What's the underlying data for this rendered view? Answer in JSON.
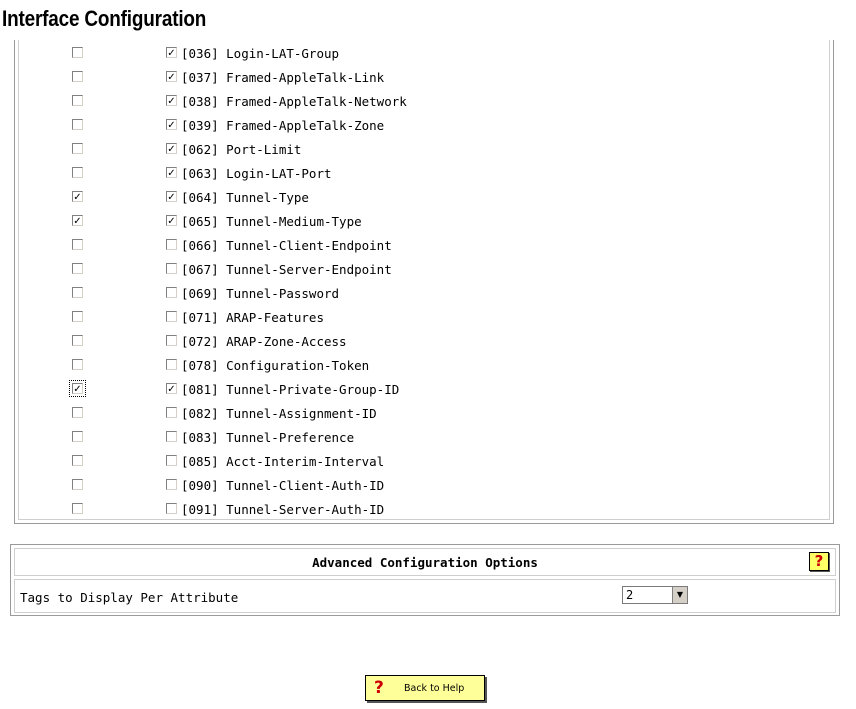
{
  "page": {
    "title": "Interface Configuration"
  },
  "attributes": [
    {
      "label": "[036] Login-LAT-Group",
      "left_checked": false,
      "right_checked": true
    },
    {
      "label": "[037] Framed-AppleTalk-Link",
      "left_checked": false,
      "right_checked": true
    },
    {
      "label": "[038] Framed-AppleTalk-Network",
      "left_checked": false,
      "right_checked": true
    },
    {
      "label": "[039] Framed-AppleTalk-Zone",
      "left_checked": false,
      "right_checked": true
    },
    {
      "label": "[062] Port-Limit",
      "left_checked": false,
      "right_checked": true
    },
    {
      "label": "[063] Login-LAT-Port",
      "left_checked": false,
      "right_checked": true
    },
    {
      "label": "[064] Tunnel-Type",
      "left_checked": true,
      "right_checked": true
    },
    {
      "label": "[065] Tunnel-Medium-Type",
      "left_checked": true,
      "right_checked": true
    },
    {
      "label": "[066] Tunnel-Client-Endpoint",
      "left_checked": false,
      "right_checked": false
    },
    {
      "label": "[067] Tunnel-Server-Endpoint",
      "left_checked": false,
      "right_checked": false
    },
    {
      "label": "[069] Tunnel-Password",
      "left_checked": false,
      "right_checked": false
    },
    {
      "label": "[071] ARAP-Features",
      "left_checked": false,
      "right_checked": false
    },
    {
      "label": "[072] ARAP-Zone-Access",
      "left_checked": false,
      "right_checked": false
    },
    {
      "label": "[078] Configuration-Token",
      "left_checked": false,
      "right_checked": false
    },
    {
      "label": "[081] Tunnel-Private-Group-ID",
      "left_checked": true,
      "right_checked": true,
      "left_focused": true
    },
    {
      "label": "[082] Tunnel-Assignment-ID",
      "left_checked": false,
      "right_checked": false
    },
    {
      "label": "[083] Tunnel-Preference",
      "left_checked": false,
      "right_checked": false
    },
    {
      "label": "[085] Acct-Interim-Interval",
      "left_checked": false,
      "right_checked": false
    },
    {
      "label": "[090] Tunnel-Client-Auth-ID",
      "left_checked": false,
      "right_checked": false
    },
    {
      "label": "[091] Tunnel-Server-Auth-ID",
      "left_checked": false,
      "right_checked": false
    }
  ],
  "advanced": {
    "title": "Advanced Configuration Options",
    "help_icon": "question-mark-icon",
    "tags_label": "Tags to Display Per Attribute",
    "tags_value": "2"
  },
  "back_button": {
    "label": "Back to Help",
    "icon": "question-mark-icon"
  },
  "colors": {
    "help_bg": "#ffff66",
    "button_bg": "#ffff99",
    "icon_red": "#cc0000"
  }
}
